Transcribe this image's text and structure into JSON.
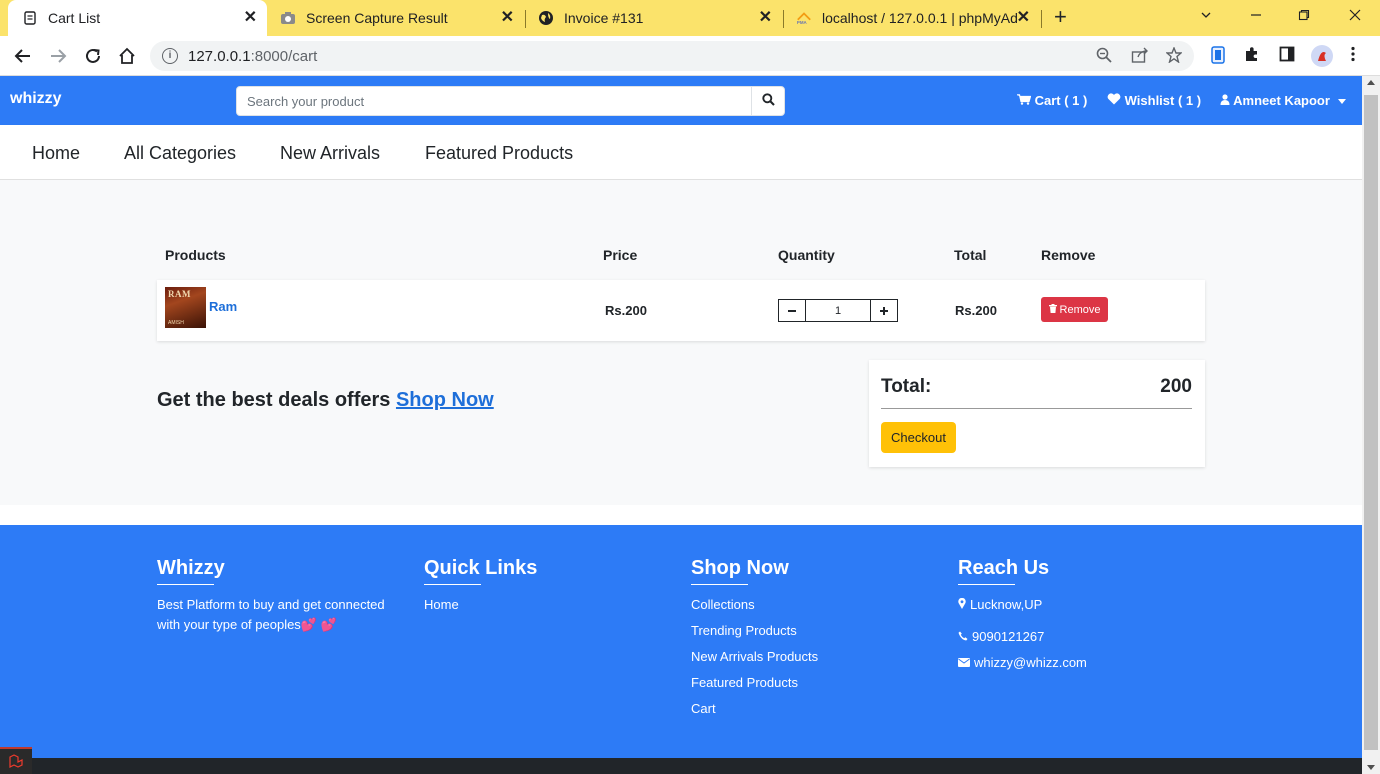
{
  "browser": {
    "tabs": [
      {
        "title": "Cart List",
        "icon": "document-icon"
      },
      {
        "title": "Screen Capture Result",
        "icon": "camera-icon"
      },
      {
        "title": "Invoice #131",
        "icon": "globe-icon"
      },
      {
        "title": "localhost / 127.0.0.1 | phpMyAdm",
        "icon": "pma-icon"
      }
    ],
    "url_host": "127.0.0.1",
    "url_path": ":8000/cart"
  },
  "header": {
    "brand": "whizzy",
    "search_placeholder": "Search your product",
    "cart": "Cart ( 1 )",
    "wishlist": "Wishlist ( 1 )",
    "user": "Amneet Kapoor"
  },
  "nav": [
    "Home",
    "All Categories",
    "New Arrivals",
    "Featured Products"
  ],
  "cart": {
    "headers": {
      "products": "Products",
      "price": "Price",
      "quantity": "Quantity",
      "total": "Total",
      "remove": "Remove"
    },
    "items": [
      {
        "thumb_title": "RAM",
        "thumb_author": "AMISH",
        "name": "Ram",
        "price": "Rs.200",
        "qty": "1",
        "total": "Rs.200",
        "remove_label": "Remove"
      }
    ],
    "deals_text": "Get the best deals offers",
    "deals_link": "Shop Now",
    "total_label": "Total:",
    "total_value": "200",
    "checkout_label": "Checkout"
  },
  "footer": {
    "about": {
      "title": "Whizzy",
      "text": "Best Platform to buy and get connected with your type of peoples💕 💕"
    },
    "quick": {
      "title": "Quick Links",
      "links": [
        "Home"
      ]
    },
    "shop": {
      "title": "Shop Now",
      "links": [
        "Collections",
        "Trending Products",
        "New Arrivals Products",
        "Featured Products",
        "Cart"
      ]
    },
    "reach": {
      "title": "Reach Us",
      "location": "Lucknow,UP",
      "phone": "9090121267",
      "email": "whizzy@whizz.com"
    }
  },
  "colors": {
    "primary": "#2d7bf6",
    "danger": "#dc3545",
    "warning": "#ffc107",
    "tabbar": "#fbe36b"
  }
}
